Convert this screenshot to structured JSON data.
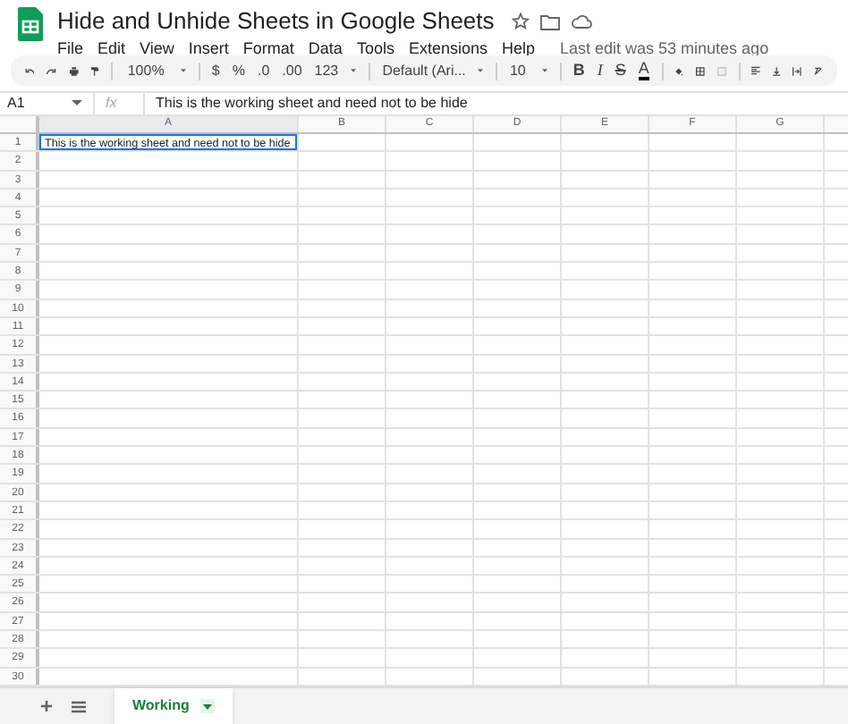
{
  "document": {
    "title": "Hide and Unhide Sheets in Google Sheets",
    "last_edit": "Last edit was 53 minutes ago"
  },
  "menu": [
    "File",
    "Edit",
    "View",
    "Insert",
    "Format",
    "Data",
    "Tools",
    "Extensions",
    "Help"
  ],
  "toolbar": {
    "zoom": "100%",
    "currency": "$",
    "percent": "%",
    "decimal_decrease": ".0",
    "decimal_increase": ".00",
    "number_format": "123",
    "font": "Default (Ari...",
    "font_size": "10",
    "bold": "B",
    "italic": "I",
    "strikethrough": "S",
    "text_color": "A"
  },
  "formula_bar": {
    "cell_ref": "A1",
    "fx": "fx",
    "value": "This is the working sheet and need not to be hide"
  },
  "columns": [
    "A",
    "B",
    "C",
    "D",
    "E",
    "F",
    "G"
  ],
  "rows": [
    "1",
    "2",
    "3",
    "4",
    "5",
    "6",
    "7",
    "8",
    "9",
    "10",
    "11",
    "12",
    "13",
    "14",
    "15",
    "16",
    "17",
    "18",
    "19",
    "20",
    "21",
    "22",
    "23",
    "24",
    "25",
    "26",
    "27",
    "28",
    "29",
    "30"
  ],
  "cell_a1": {
    "text": "This is the working sheet and need not to be hide",
    "selected": true
  },
  "sheet_tabs": [
    {
      "label": "Working",
      "selected": true
    }
  ]
}
